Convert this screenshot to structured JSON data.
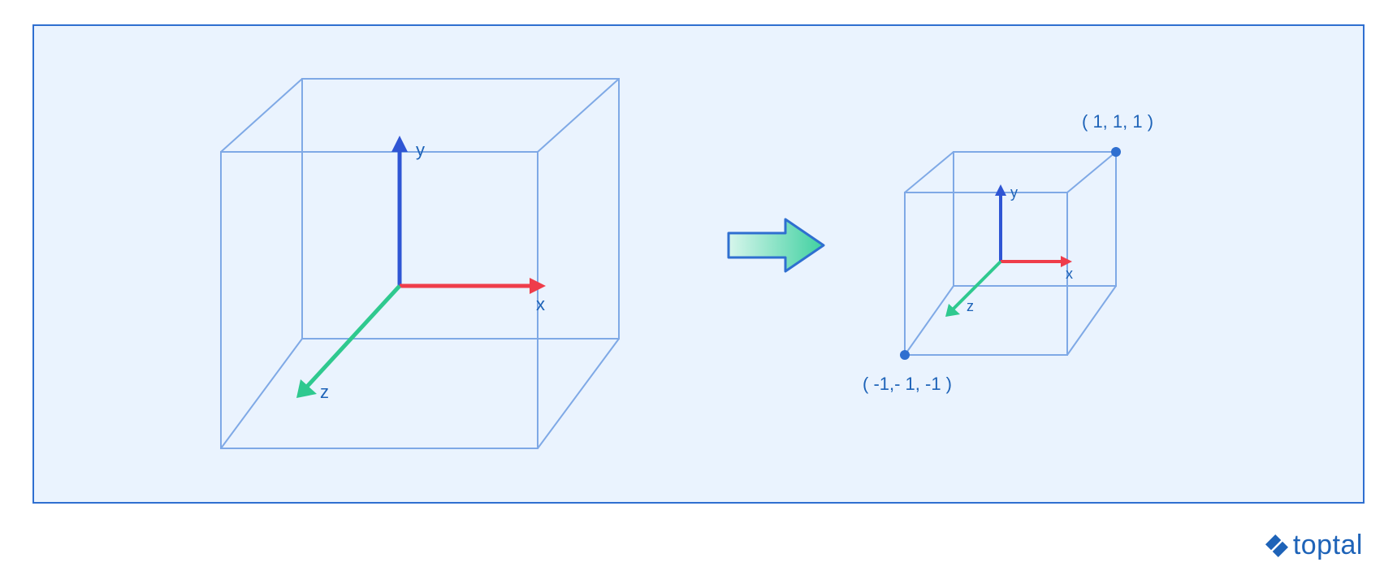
{
  "brand": "toptal",
  "axes": {
    "x": "x",
    "y": "y",
    "z": "z"
  },
  "cube_small": {
    "top_right_label": "( 1, 1, 1 )",
    "bottom_left_label": "( -1,- 1, -1 )"
  },
  "colors": {
    "panel_bg": "#eaf3fe",
    "panel_border": "#2f6fd0",
    "cube_stroke": "#7fa9e6",
    "axis_x": "#ef3d4a",
    "axis_y": "#2f55d4",
    "axis_z": "#2fc98f",
    "label": "#1e63b8",
    "arrow_outline": "#2f6fd0",
    "arrow_grad_start": "#bff0e1",
    "arrow_grad_end": "#2fc98f"
  }
}
